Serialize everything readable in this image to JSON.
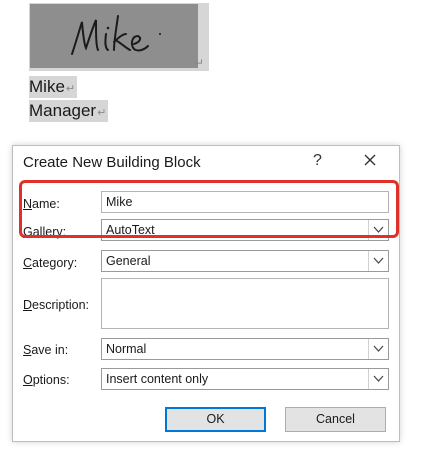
{
  "document": {
    "signature_text": "Mike",
    "paragraph_mark": "↵",
    "line1": "Mike",
    "line2": "Manager"
  },
  "dialog": {
    "title": "Create New Building Block",
    "help_label": "?",
    "fields": {
      "name": {
        "label_u": "N",
        "label_rest": "ame:",
        "value": "Mike"
      },
      "gallery": {
        "label_u": "G",
        "label_rest": "allery:",
        "value": "AutoText"
      },
      "category": {
        "label_u": "C",
        "label_rest": "ategory:",
        "value": "General"
      },
      "description": {
        "label_u": "D",
        "label_rest": "escription:",
        "value": ""
      },
      "save_in": {
        "label_u": "S",
        "label_rest": "ave in:",
        "value": "Normal"
      },
      "options": {
        "label_u": "O",
        "label_rest": "ptions:",
        "value": "Insert content only"
      }
    },
    "ok_label": "OK",
    "cancel_label": "Cancel"
  },
  "colors": {
    "highlight": "#e0302a",
    "default_button_border": "#0078d7"
  },
  "icons": {
    "close": "close-icon",
    "dropdown": "chevron-down-icon"
  }
}
